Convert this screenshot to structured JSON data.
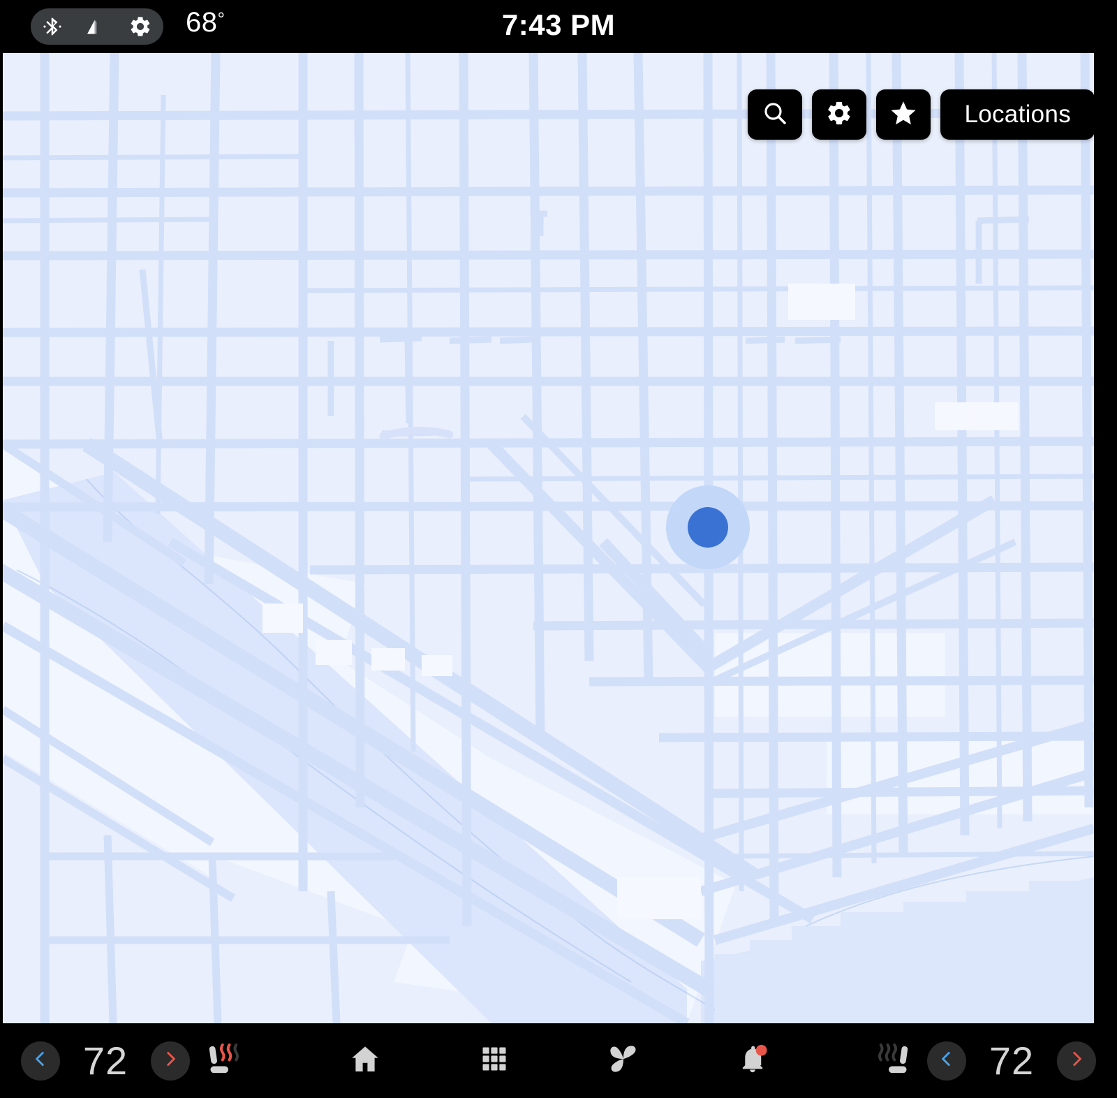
{
  "status_bar": {
    "bluetooth_icon": "bluetooth-icon",
    "signal_icon": "cellular-signal-icon",
    "gear_icon": "gear-icon",
    "temperature": "68",
    "degree_symbol": "°",
    "clock": "7:43 PM"
  },
  "map": {
    "background_color": "#e9effc",
    "road_color": "#d2dff9",
    "water_color": "#dbe5fb",
    "park_color": "#f3f7fe",
    "location_dot_color": "#3a72d3",
    "location_halo_color": "#c3d7f8",
    "location_marker_name": "current-location-puck"
  },
  "map_controls": {
    "search": {
      "icon": "search-icon",
      "label": "Search"
    },
    "settings": {
      "icon": "gear-icon",
      "label": "Settings"
    },
    "favorites": {
      "icon": "star-icon",
      "label": "Favorites"
    },
    "locations": {
      "label": "Locations"
    }
  },
  "climate": {
    "left": {
      "decrease_icon": "chevron-left-icon",
      "decrease_color": "#4aa3e8",
      "temperature": "72",
      "increase_icon": "chevron-right-icon",
      "increase_color": "#e8564a",
      "seat_icon": "heated-seat-icon",
      "seat_active": true,
      "seat_heat_color": "#e8564a"
    },
    "right": {
      "decrease_icon": "chevron-left-icon",
      "decrease_color": "#4aa3e8",
      "temperature": "72",
      "increase_icon": "chevron-right-icon",
      "increase_color": "#e8564a",
      "seat_icon": "heated-seat-icon",
      "seat_active": false,
      "seat_heat_color": "#3a3a3a"
    }
  },
  "nav_bar": {
    "items": [
      {
        "name": "home",
        "icon": "home-icon"
      },
      {
        "name": "apps",
        "icon": "apps-grid-icon"
      },
      {
        "name": "climate",
        "icon": "fan-icon"
      },
      {
        "name": "notifications",
        "icon": "bell-icon",
        "badge": true,
        "badge_color": "#e8564a"
      }
    ]
  }
}
